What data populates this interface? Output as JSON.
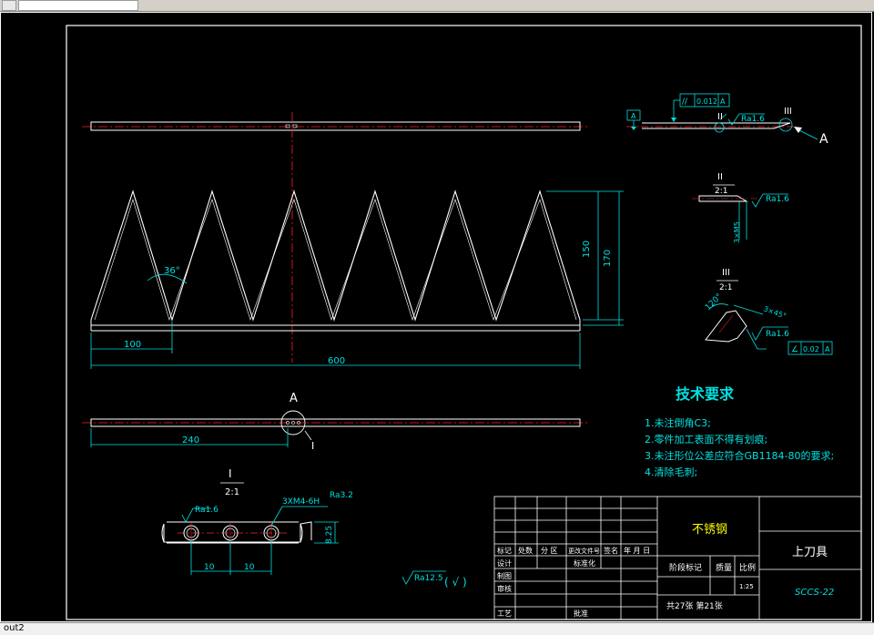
{
  "drawing": {
    "dims": {
      "angle": "36°",
      "tooth_height": "150",
      "total_height": "170",
      "pitch": "100",
      "length": "600",
      "hole_offset": "240",
      "hole_pitch_1": "10",
      "hole_pitch_2": "10",
      "height_825": "8.25",
      "chamfer": "3×M5",
      "angle_120": "120°",
      "angle_45": "3×45°"
    },
    "callouts": {
      "view_a_flag": "A",
      "section_a": "A",
      "section_i": "I",
      "detail_ii": "II",
      "detail_iii": "III",
      "detail_i_title": "I",
      "detail_i_scale": "2:1",
      "detail_ii_title": "II",
      "detail_ii_scale": "2:1",
      "detail_iii_title": "III",
      "detail_iii_scale": "2:1",
      "arrow_a": "A"
    },
    "tolerances": {
      "parallel": "//",
      "parallel_val": "0.012",
      "parallel_ref": "A",
      "angularity_val": "0.02",
      "angularity_ref": "A",
      "roughness_top": "Ra1.6",
      "roughness_ii": "Ra1.6",
      "roughness_iii": "Ra1.6",
      "roughness_i_left": "Ra1.6",
      "roughness_i_right": "Ra3.2",
      "thread": "3XM4-6H",
      "roughness_general": "Ra12.5",
      "roughness_general_sym": "( √ )"
    },
    "tech_req": {
      "title": "技术要求",
      "lines": [
        "1.未注倒角C3;",
        "2.零件加工表面不得有划痕;",
        "3.未注形位公差应符合GB1184-80的要求;",
        "4.清除毛刺;"
      ]
    },
    "title_block": {
      "material": "不锈钢",
      "part_name": "上刀具",
      "drawing_no": "SCCS-22",
      "scale_label": "比例",
      "weight_label": "质量",
      "stage_label": "阶段标记",
      "scale_value": "1:25",
      "sheet_info": "共27张 第21张",
      "row_labels": [
        "标记",
        "处数",
        "分 区",
        "更改文件号",
        "签名",
        "年 月 日"
      ],
      "side_labels": [
        "设计",
        "制图",
        "审核",
        "工艺"
      ],
      "std_label": "标准化",
      "approve_label": "批准"
    }
  },
  "statusbar": {
    "layout_tab": "out2"
  },
  "colors": {
    "background": "#000000",
    "line": "#ffffff",
    "center": "#ff2020",
    "dim": "#00e0e0",
    "table": "#ffffff",
    "yellow": "#ffff00"
  }
}
